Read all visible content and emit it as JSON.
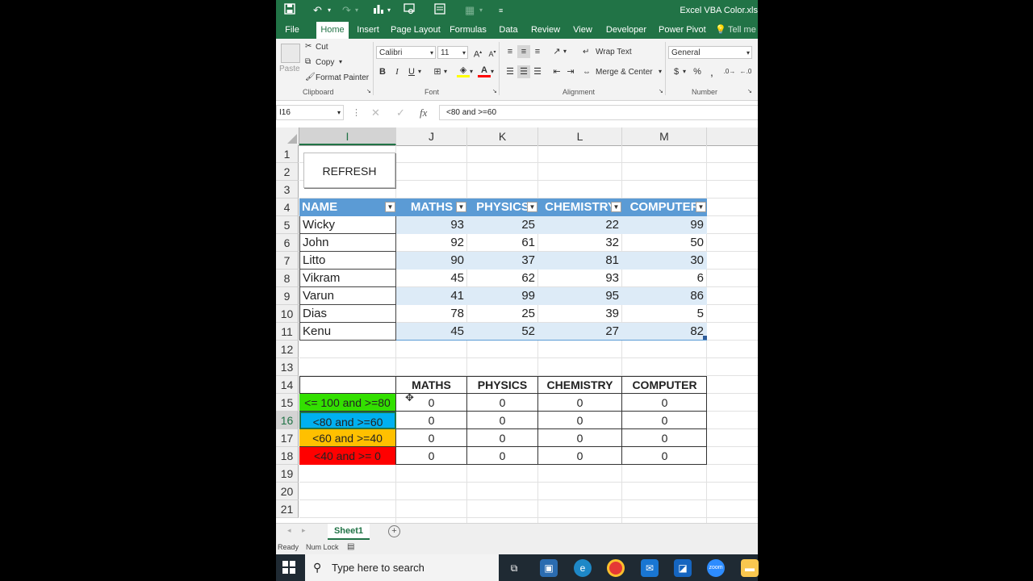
{
  "window": {
    "title": "Excel VBA Color.xls"
  },
  "tabs": [
    {
      "label": "File"
    },
    {
      "label": "Home"
    },
    {
      "label": "Insert"
    },
    {
      "label": "Page Layout"
    },
    {
      "label": "Formulas"
    },
    {
      "label": "Data"
    },
    {
      "label": "Review"
    },
    {
      "label": "View"
    },
    {
      "label": "Developer"
    },
    {
      "label": "Power Pivot"
    },
    {
      "label": "Tell me w"
    }
  ],
  "ribbon": {
    "paste": "Paste",
    "cut": "Cut",
    "copy": "Copy",
    "format_painter": "Format Painter",
    "clipboard": "Clipboard",
    "font_name": "Calibri",
    "font_size": "11",
    "bold": "B",
    "italic": "I",
    "underline": "U",
    "font": "Font",
    "wrap_text": "Wrap Text",
    "merge_center": "Merge & Center",
    "alignment": "Alignment",
    "number_format": "General",
    "currency": "$",
    "percent": "%",
    "number": "Number"
  },
  "formula_bar": {
    "name_box": "I16",
    "fx": "fx",
    "formula": "<80 and >=60"
  },
  "columns": [
    "I",
    "J",
    "K",
    "L",
    "M"
  ],
  "rows": [
    "1",
    "2",
    "3",
    "4",
    "5",
    "6",
    "7",
    "8",
    "9",
    "10",
    "11",
    "12",
    "13",
    "14",
    "15",
    "16",
    "17",
    "18",
    "19",
    "20",
    "21"
  ],
  "refresh_button": "REFRESH",
  "table": {
    "headers": [
      "NAME",
      "MATHS",
      "PHYSICS",
      "CHEMISTRY",
      "COMPUTER"
    ],
    "rows": [
      [
        "Wicky",
        "93",
        "25",
        "22",
        "99"
      ],
      [
        "John",
        "92",
        "61",
        "32",
        "50"
      ],
      [
        "Litto",
        "90",
        "37",
        "81",
        "30"
      ],
      [
        "Vikram",
        "45",
        "62",
        "93",
        "6"
      ],
      [
        "Varun",
        "41",
        "99",
        "95",
        "86"
      ],
      [
        "Dias",
        "78",
        "25",
        "39",
        "5"
      ],
      [
        "Kenu",
        "45",
        "52",
        "27",
        "82"
      ]
    ]
  },
  "summary": {
    "headers": [
      "MATHS",
      "PHYSICS",
      "CHEMISTRY",
      "COMPUTER"
    ],
    "rows": [
      {
        "label": "<= 100 and >=80",
        "color": "#33e000",
        "values": [
          "0",
          "0",
          "0",
          "0"
        ]
      },
      {
        "label": "<80 and >=60",
        "color": "#00b0f0",
        "values": [
          "0",
          "0",
          "0",
          "0"
        ]
      },
      {
        "label": "<60 and >=40",
        "color": "#ffc000",
        "values": [
          "0",
          "0",
          "0",
          "0"
        ]
      },
      {
        "label": "<40 and >= 0",
        "color": "#ff0000",
        "values": [
          "0",
          "0",
          "0",
          "0"
        ]
      }
    ]
  },
  "sheet_tab": "Sheet1",
  "status": {
    "ready": "Ready",
    "numlock": "Num Lock"
  },
  "taskbar": {
    "search_placeholder": "Type here to search"
  },
  "colors": {
    "excel_green": "#217346",
    "table_header": "#5b9bd5",
    "table_band": "#ddebf7"
  }
}
